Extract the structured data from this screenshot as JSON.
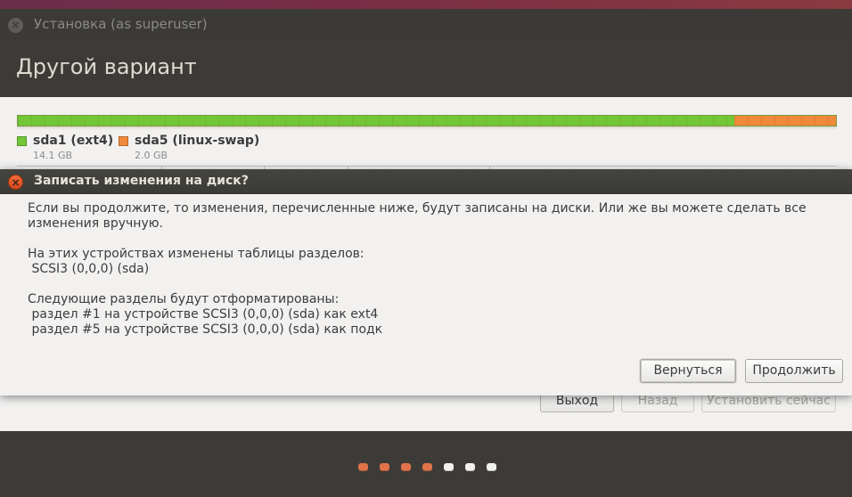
{
  "main_window": {
    "title": "Установка (as superuser)",
    "close_glyph": "×",
    "page_title": "Другой вариант"
  },
  "disk": {
    "partitions": [
      {
        "name": "sda1 (ext4)",
        "size": "14.1 GB",
        "color": "#73c638",
        "fraction": 0.876
      },
      {
        "name": "sda5 (linux-swap)",
        "size": "2.0 GB",
        "color": "#f0893a",
        "fraction": 0.124
      }
    ]
  },
  "main_buttons": {
    "quit": "Выход",
    "back": "Назад",
    "install_now": "Установить сейчас"
  },
  "dialog": {
    "title": "Записать изменения на диск?",
    "close_glyph": "×",
    "intro": "Если вы продолжите, то изменения, перечисленные ниже, будут записаны на диски. Или же вы можете сделать все изменения вручную.",
    "changed_tables_heading": "На этих устройствах изменены таблицы разделов:",
    "changed_tables_device": " SCSI3 (0,0,0) (sda)",
    "format_heading": "Следующие разделы будут отформатированы:",
    "format_item_1": " раздел #1 на устройстве SCSI3 (0,0,0) (sda) как ext4",
    "format_item_2": " раздел #5 на устройстве SCSI3 (0,0,0) (sda) как подк",
    "back_button": "Вернуться",
    "continue_button": "Продолжить"
  },
  "progress": {
    "total_steps": 7,
    "completed_steps": 4,
    "active_color": "#e0734a",
    "inactive_color": "#f2f1f0"
  }
}
